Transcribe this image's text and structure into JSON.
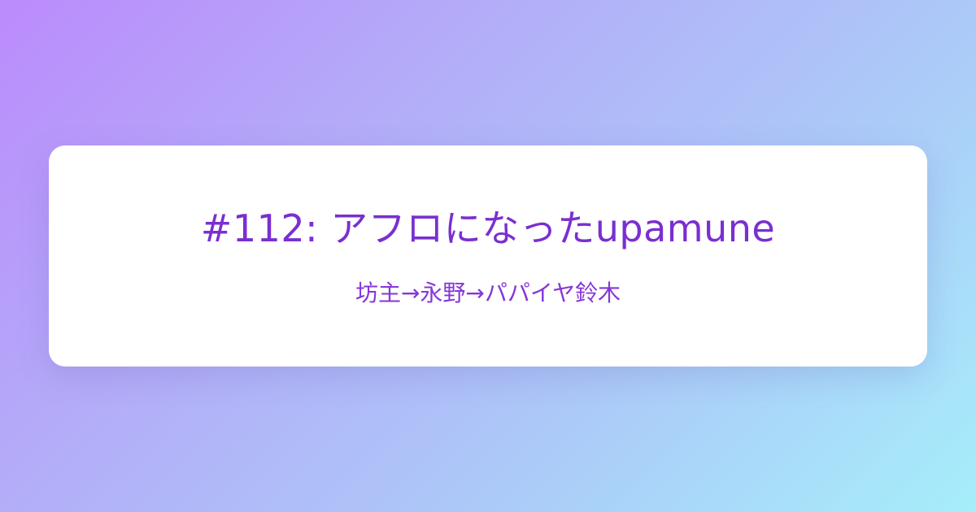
{
  "episode": {
    "title": "#112: アフロになったupamune",
    "subtitle": "坊主→永野→パパイヤ鈴木"
  },
  "colors": {
    "gradient_start": "#bb8bfc",
    "gradient_end": "#a6eefa",
    "card_background": "#ffffff",
    "text_accent": "#7a2fd0"
  }
}
